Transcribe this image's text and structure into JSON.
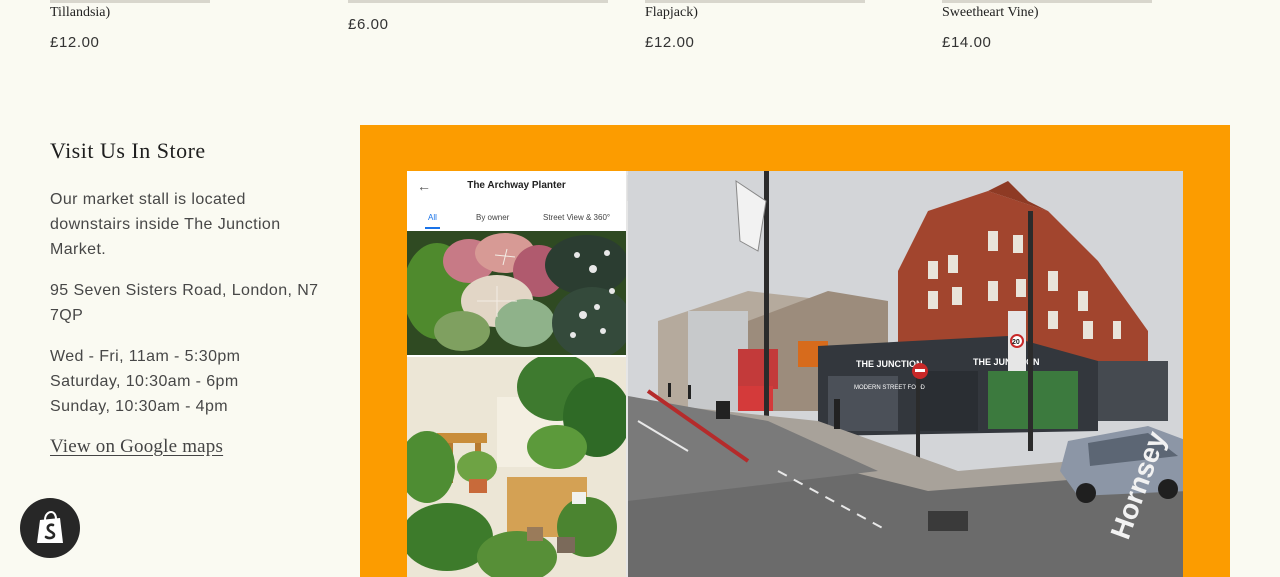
{
  "products": [
    {
      "name_tail": "Tillandsia)",
      "price": "£12.00"
    },
    {
      "name_tail": "",
      "price": "£6.00"
    },
    {
      "name_tail": "Flapjack)",
      "price": "£12.00"
    },
    {
      "name_tail": "Sweetheart Vine)",
      "price": "£14.00"
    }
  ],
  "store": {
    "title": "Visit Us In Store",
    "description": "Our market stall is located downstairs inside The Junction Market.",
    "address": "95 Seven Sisters Road, London, N7 7QP",
    "hours": [
      "Wed - Fri, 11am - 5:30pm",
      "Saturday, 10:30am - 6pm",
      "Sunday, 10:30am - 4pm"
    ],
    "maps_link": "View on Google maps"
  },
  "map_panel": {
    "place_name": "The Archway Planter",
    "tabs": [
      "All",
      "By owner",
      "Street View & 360°"
    ],
    "back_icon": "arrow-left-icon",
    "collapse_icon": "chevron-left-icon",
    "street_signs": {
      "shop_name": "THE JUNCTION",
      "shop_name_2": "THE JUNCTION",
      "window_text": "MODERN STREET FOOD",
      "speed_limit": "20",
      "road_text": "Hornsey"
    }
  },
  "colors": {
    "background": "#fafaf2",
    "map_frame": "#fc9c00",
    "link": "#444444",
    "badge": "#272727"
  },
  "shop_badge_icon": "shopify-bag-icon"
}
